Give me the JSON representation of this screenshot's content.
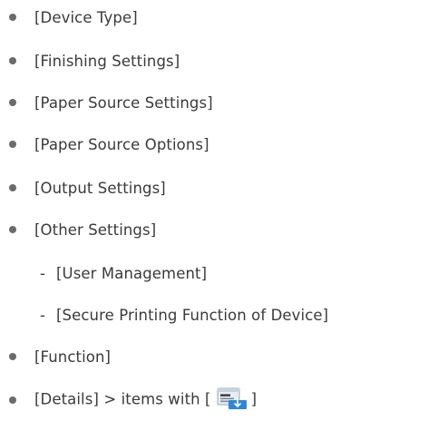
{
  "items": [
    {
      "label": "[Device Type]"
    },
    {
      "label": "[Finishing Settings]"
    },
    {
      "label": "[Paper Source Settings]"
    },
    {
      "label": "[Paper Source Options]"
    },
    {
      "label": "[Output Settings]"
    },
    {
      "label": "[Other Settings]"
    },
    {
      "label": "[User Management]",
      "prefix": "-"
    },
    {
      "label": "[Secure Printing Function of Device]",
      "prefix": "-"
    },
    {
      "label": "[Function]"
    },
    {
      "label_prefix": "[Details] > items with [",
      "label_suffix": "]",
      "icon": "settings-dialog-icon"
    }
  ]
}
